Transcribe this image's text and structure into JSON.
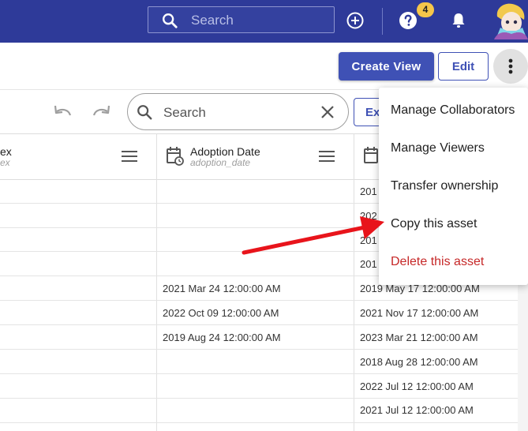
{
  "topbar": {
    "search_placeholder": "Search",
    "notification_count": "4"
  },
  "actions": {
    "create_view": "Create View",
    "edit": "Edit"
  },
  "toolbar": {
    "search_placeholder": "Search",
    "export_label": "Ex"
  },
  "columns": [
    {
      "title": "ex",
      "subtitle": "ex"
    },
    {
      "title": "Adoption Date",
      "subtitle": "adoption_date"
    }
  ],
  "rows": [
    {
      "adoption": "",
      "next": "201"
    },
    {
      "adoption": "",
      "next": "202"
    },
    {
      "adoption": "",
      "next": "201"
    },
    {
      "adoption": "",
      "next": "201"
    },
    {
      "adoption": "2021 Mar 24 12:00:00 AM",
      "next": "2019 May 17 12:00:00 AM"
    },
    {
      "adoption": "2022 Oct 09 12:00:00 AM",
      "next": "2021 Nov 17 12:00:00 AM"
    },
    {
      "adoption": "2019 Aug 24 12:00:00 AM",
      "next": "2023 Mar 21 12:00:00 AM"
    },
    {
      "adoption": "",
      "next": "2018 Aug 28 12:00:00 AM"
    },
    {
      "adoption": "",
      "next": "2022 Jul 12 12:00:00 AM"
    },
    {
      "adoption": "",
      "next": "2021 Jul 12 12:00:00 AM"
    }
  ],
  "menu": {
    "items": [
      {
        "label": "Manage Collaborators"
      },
      {
        "label": "Manage Viewers"
      },
      {
        "label": "Transfer ownership"
      },
      {
        "label": "Copy this asset"
      },
      {
        "label": "Delete this asset"
      }
    ]
  },
  "colors": {
    "topbar": "#2e3a99",
    "primary": "#3f51b5",
    "danger": "#c62828",
    "annotation_arrow": "#e8141b"
  }
}
